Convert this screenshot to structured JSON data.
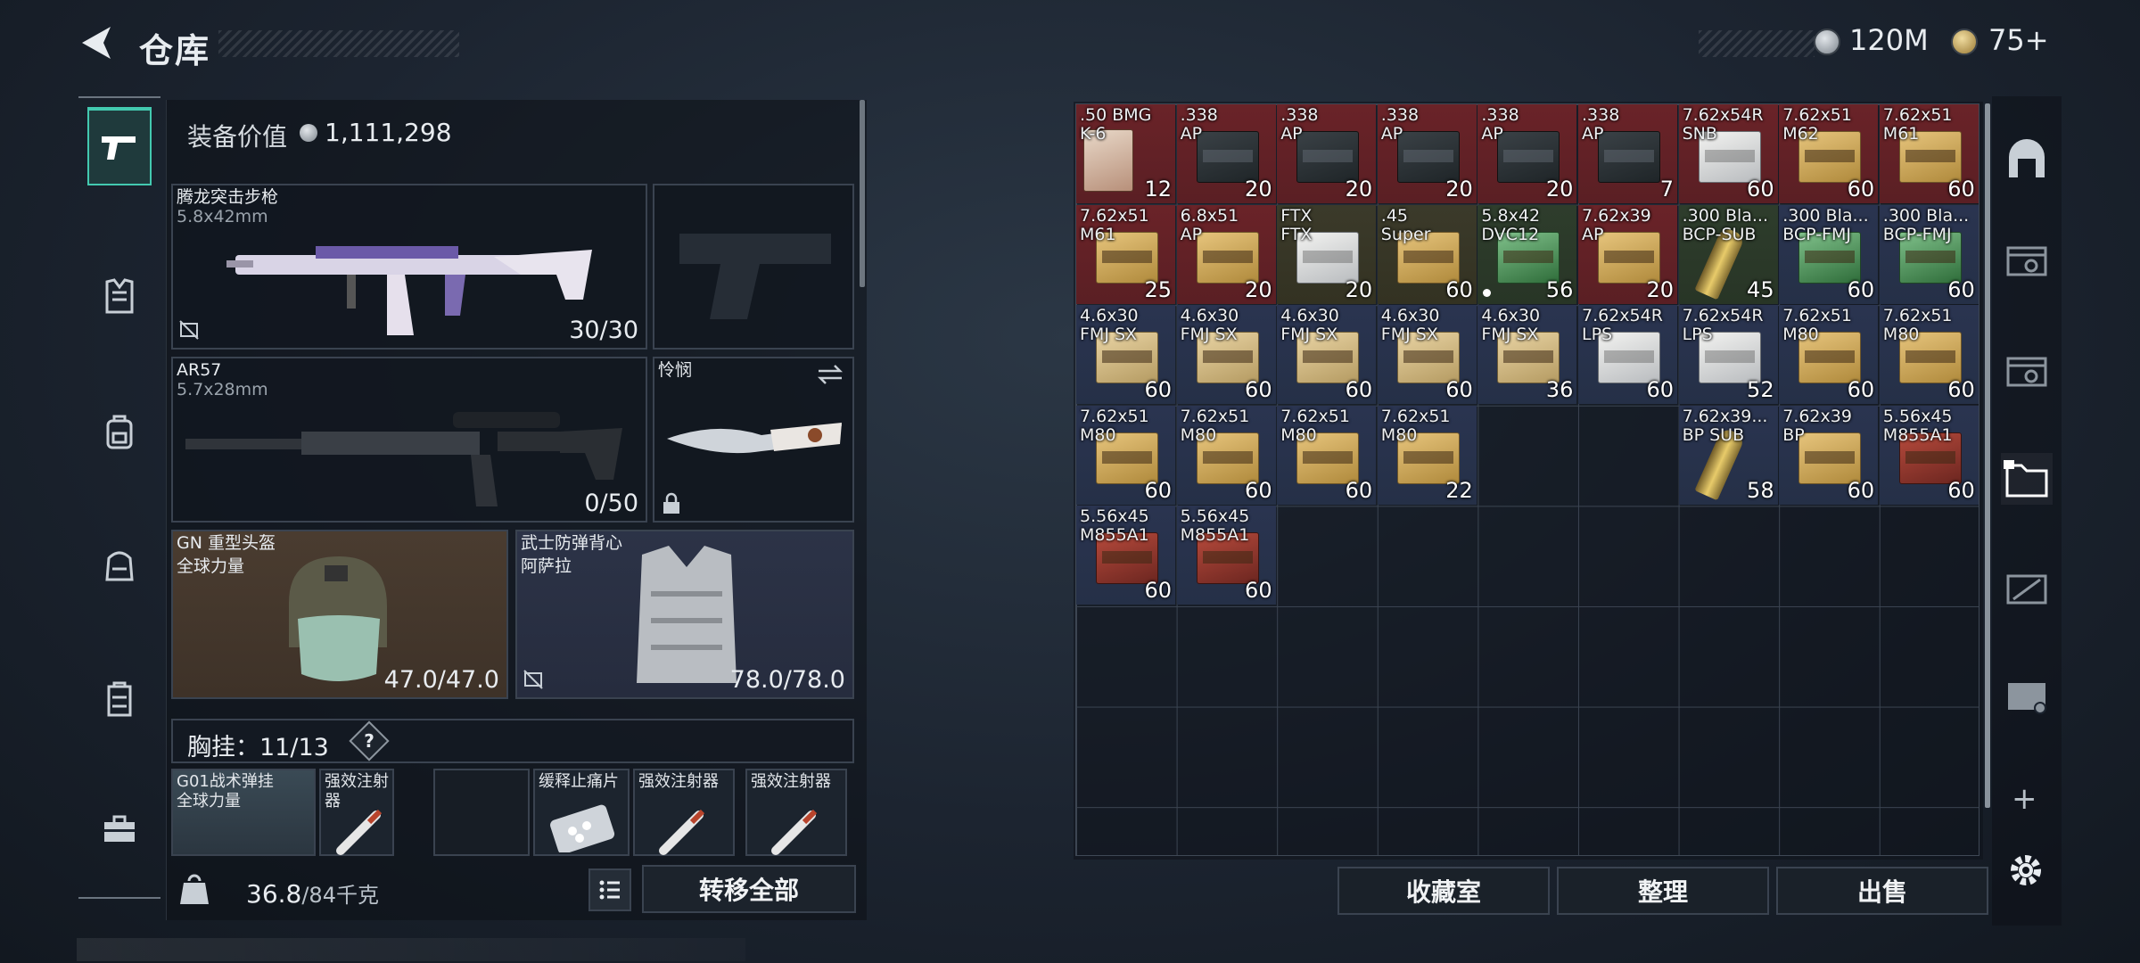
{
  "header": {
    "title": "仓库",
    "currency_silver": "120M",
    "currency_gold": "75+"
  },
  "sidebar": {
    "tabs": [
      "weapon",
      "armor",
      "backpack",
      "bag",
      "vest",
      "toolbox"
    ]
  },
  "equipment": {
    "value_label": "装备价值",
    "value": "1,111,298",
    "primary": {
      "name": "腾龙突击步枪",
      "caliber": "5.8x42mm",
      "ammo": "30/30"
    },
    "secondary": {
      "name": "AR57",
      "caliber": "5.7x28mm",
      "ammo": "0/50"
    },
    "melee": {
      "name": "怜悯"
    },
    "helmet": {
      "name": "GN 重型头盔",
      "sub": "全球力量",
      "durability": "47.0/47.0"
    },
    "armor": {
      "name": "武士防弹背心",
      "sub": "阿萨拉",
      "durability": "78.0/78.0"
    },
    "vest_label": "胸挂：",
    "vest_count": "11/13",
    "vest_help": "?",
    "vest_slots": [
      {
        "name": "G01战术弹挂",
        "sub": "全球力量"
      },
      {
        "name": "强效注射器"
      },
      {
        "name": ""
      },
      {
        "name": "缓释止痛片"
      },
      {
        "name": "强效注射器"
      },
      {
        "name": "强效注射器"
      }
    ]
  },
  "footer_left": {
    "weight": "36.8",
    "weight_max": "/84千克",
    "move_all": "转移全部"
  },
  "footer_right": {
    "buttons": [
      "收藏室",
      "整理",
      "出售"
    ]
  },
  "inventory": [
    {
      "line1": ".50 BMG",
      "line2": "K-6",
      "qty": "12",
      "bg": "red",
      "box": "card50"
    },
    {
      "line1": ".338",
      "line2": "AP",
      "qty": "20",
      "bg": "red",
      "box": "dark"
    },
    {
      "line1": ".338",
      "line2": "AP",
      "qty": "20",
      "bg": "red",
      "box": "dark"
    },
    {
      "line1": ".338",
      "line2": "AP",
      "qty": "20",
      "bg": "red",
      "box": "dark"
    },
    {
      "line1": ".338",
      "line2": "AP",
      "qty": "20",
      "bg": "red",
      "box": "dark"
    },
    {
      "line1": ".338",
      "line2": "AP",
      "qty": "7",
      "bg": "red",
      "box": "dark"
    },
    {
      "line1": "7.62x54R",
      "line2": "SNB",
      "qty": "60",
      "bg": "red",
      "box": "white"
    },
    {
      "line1": "7.62x51",
      "line2": "M62",
      "qty": "60",
      "bg": "red",
      "box": "khaki"
    },
    {
      "line1": "7.62x51",
      "line2": "M61",
      "qty": "60",
      "bg": "red",
      "box": "khaki"
    },
    {
      "line1": "7.62x51",
      "line2": "M61",
      "qty": "25",
      "bg": "red",
      "box": "khaki"
    },
    {
      "line1": "6.8x51",
      "line2": "AP",
      "qty": "20",
      "bg": "red",
      "box": "khaki"
    },
    {
      "line1": "FTX",
      "line2": "FTX",
      "qty": "20",
      "bg": "olive",
      "box": "white"
    },
    {
      "line1": ".45",
      "line2": "Super",
      "qty": "60",
      "bg": "olive",
      "box": "khaki"
    },
    {
      "line1": "5.8x42",
      "line2": "DVC12",
      "qty": "56",
      "bg": "green",
      "box": "greenb",
      "dot": true
    },
    {
      "line1": "7.62x39",
      "line2": "AP",
      "qty": "20",
      "bg": "red",
      "box": "khaki"
    },
    {
      "line1": ".300 Bla...",
      "line2": "BCP-SUB",
      "qty": "45",
      "bg": "green",
      "box": "bullet"
    },
    {
      "line1": ".300 Bla...",
      "line2": "BCP-FMJ",
      "qty": "60",
      "bg": "blue",
      "box": "greenb"
    },
    {
      "line1": ".300 Bla...",
      "line2": "BCP-FMJ",
      "qty": "60",
      "bg": "blue",
      "box": "greenb"
    },
    {
      "line1": "4.6x30",
      "line2": "FMJ SX",
      "qty": "60",
      "bg": "blue",
      "box": "tan"
    },
    {
      "line1": "4.6x30",
      "line2": "FMJ SX",
      "qty": "60",
      "bg": "blue",
      "box": "tan"
    },
    {
      "line1": "4.6x30",
      "line2": "FMJ SX",
      "qty": "60",
      "bg": "blue",
      "box": "tan"
    },
    {
      "line1": "4.6x30",
      "line2": "FMJ SX",
      "qty": "60",
      "bg": "blue",
      "box": "tan"
    },
    {
      "line1": "4.6x30",
      "line2": "FMJ SX",
      "qty": "36",
      "bg": "blue",
      "box": "tan"
    },
    {
      "line1": "7.62x54R",
      "line2": "LPS",
      "qty": "60",
      "bg": "blue",
      "box": "white"
    },
    {
      "line1": "7.62x54R",
      "line2": "LPS",
      "qty": "52",
      "bg": "blue",
      "box": "white"
    },
    {
      "line1": "7.62x51",
      "line2": "M80",
      "qty": "60",
      "bg": "blue",
      "box": "khaki"
    },
    {
      "line1": "7.62x51",
      "line2": "M80",
      "qty": "60",
      "bg": "blue",
      "box": "khaki"
    },
    {
      "line1": "7.62x51",
      "line2": "M80",
      "qty": "60",
      "bg": "blue",
      "box": "khaki"
    },
    {
      "line1": "7.62x51",
      "line2": "M80",
      "qty": "60",
      "bg": "blue",
      "box": "khaki"
    },
    {
      "line1": "7.62x51",
      "line2": "M80",
      "qty": "60",
      "bg": "blue",
      "box": "khaki"
    },
    {
      "line1": "7.62x51",
      "line2": "M80",
      "qty": "22",
      "bg": "blue",
      "box": "khaki"
    },
    {
      "line1": "7.62x39...",
      "line2": "BP SUB",
      "qty": "58",
      "bg": "blue",
      "box": "bullet"
    },
    {
      "line1": "7.62x39",
      "line2": "BP",
      "qty": "60",
      "bg": "blue",
      "box": "khaki"
    },
    {
      "line1": "5.56x45",
      "line2": "M855A1",
      "qty": "60",
      "bg": "blue",
      "box": "redb"
    },
    {
      "line1": "5.56x45",
      "line2": "M855A1",
      "qty": "60",
      "bg": "blue",
      "box": "redb"
    },
    {
      "line1": "5.56x45",
      "line2": "M855A1",
      "qty": "60",
      "bg": "blue",
      "box": "redb"
    }
  ],
  "colors": {
    "accent": "#43c9b0",
    "cell_red": "#5a1f24",
    "cell_blue": "#253047",
    "cell_green": "#283526"
  }
}
